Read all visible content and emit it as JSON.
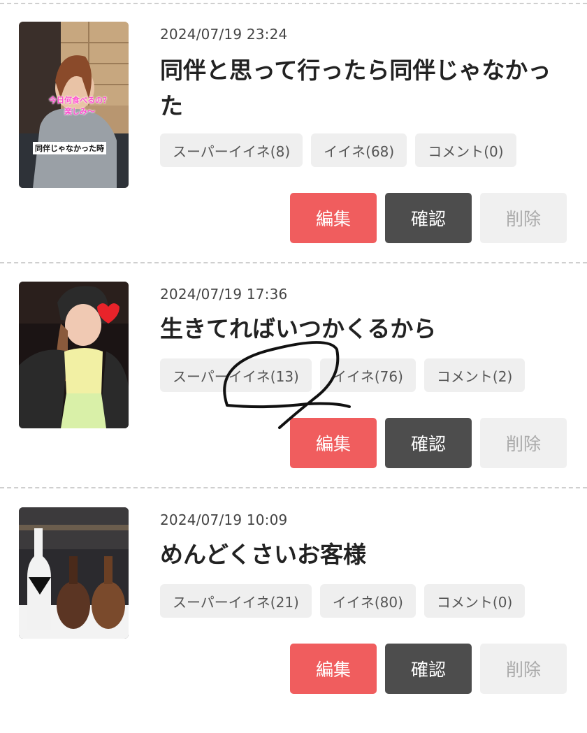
{
  "posts": [
    {
      "date": "2024/07/19 23:24",
      "title": "同伴と思って行ったら同伴じゃなかった",
      "thumb_caption_1": "今日何食べるの？",
      "thumb_caption_2": "楽しみ〜",
      "thumb_caption_3": "同伴じゃなかった時",
      "super_like": "スーパーイイネ(8)",
      "like": "イイネ(68)",
      "comment": "コメント(0)",
      "edit": "編集",
      "confirm": "確認",
      "delete": "削除"
    },
    {
      "date": "2024/07/19 17:36",
      "title": "生きてればいつかくるから",
      "super_like": "スーパーイイネ(13)",
      "like": "イイネ(76)",
      "comment": "コメント(2)",
      "edit": "編集",
      "confirm": "確認",
      "delete": "削除"
    },
    {
      "date": "2024/07/19 10:09",
      "title": "めんどくさいお客様",
      "super_like": "スーパーイイネ(21)",
      "like": "イイネ(80)",
      "comment": "コメント(0)",
      "edit": "編集",
      "confirm": "確認",
      "delete": "削除"
    }
  ],
  "colors": {
    "edit_button": "#f05d5e",
    "confirm_button": "#4d4d4d",
    "delete_button": "#f0f0f0",
    "chip_bg": "#efefef"
  }
}
